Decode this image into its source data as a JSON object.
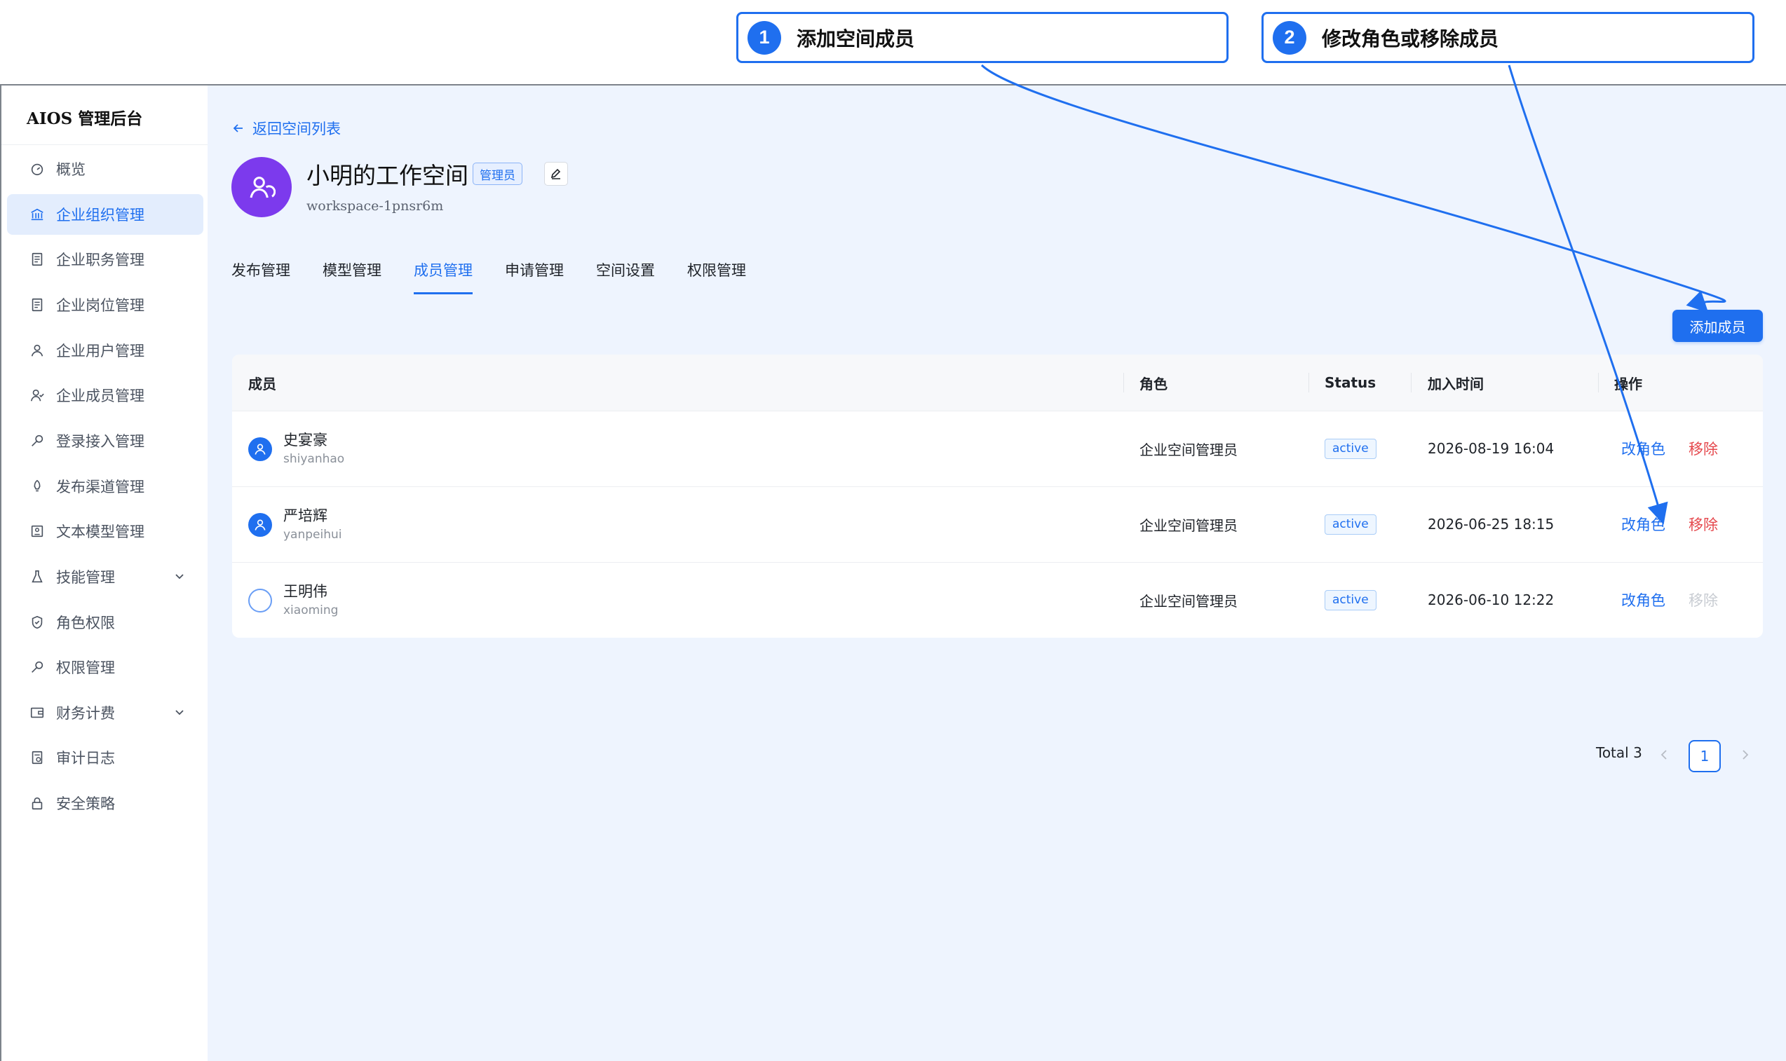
{
  "callouts": [
    {
      "number": "1",
      "text": "添加空间成员"
    },
    {
      "number": "2",
      "text": "修改角色或移除成员"
    }
  ],
  "brand": "AIOS 管理后台",
  "sidebar": {
    "items": [
      {
        "label": "概览",
        "icon": "dashboard-icon"
      },
      {
        "label": "企业组织管理",
        "icon": "bank-icon",
        "active": true
      },
      {
        "label": "企业职务管理",
        "icon": "document-icon"
      },
      {
        "label": "企业岗位管理",
        "icon": "document-icon"
      },
      {
        "label": "企业用户管理",
        "icon": "user-icon"
      },
      {
        "label": "企业成员管理",
        "icon": "users-icon"
      },
      {
        "label": "登录接入管理",
        "icon": "key-icon"
      },
      {
        "label": "发布渠道管理",
        "icon": "rocket-icon"
      },
      {
        "label": "文本模型管理",
        "icon": "model-icon"
      },
      {
        "label": "技能管理",
        "icon": "flask-icon",
        "expandable": true
      },
      {
        "label": "角色权限",
        "icon": "shield-icon"
      },
      {
        "label": "权限管理",
        "icon": "key-icon"
      },
      {
        "label": "财务计费",
        "icon": "wallet-icon",
        "expandable": true
      },
      {
        "label": "审计日志",
        "icon": "log-icon"
      },
      {
        "label": "安全策略",
        "icon": "lock-icon"
      }
    ]
  },
  "header": {
    "back_label": "返回空间列表",
    "workspace_name": "小明的工作空间",
    "role_badge": "管理员",
    "workspace_id": "workspace-1pnsr6m"
  },
  "tabs": [
    {
      "label": "发布管理"
    },
    {
      "label": "模型管理"
    },
    {
      "label": "成员管理",
      "active": true
    },
    {
      "label": "申请管理"
    },
    {
      "label": "空间设置"
    },
    {
      "label": "权限管理"
    }
  ],
  "add_member_label": "添加成员",
  "table": {
    "columns": [
      "成员",
      "角色",
      "Status",
      "加入时间",
      "操作"
    ],
    "rows": [
      {
        "name": "史宴豪",
        "login": "shiyanhao",
        "role": "企业空间管理员",
        "status": "active",
        "joined": "2026-08-19 16:04",
        "action_role": "改角色",
        "action_remove": "移除",
        "remove_disabled": false,
        "avatar": "filled"
      },
      {
        "name": "严培辉",
        "login": "yanpeihui",
        "role": "企业空间管理员",
        "status": "active",
        "joined": "2026-06-25 18:15",
        "action_role": "改角色",
        "action_remove": "移除",
        "remove_disabled": false,
        "avatar": "filled"
      },
      {
        "name": "王明伟",
        "login": "xiaoming",
        "role": "企业空间管理员",
        "status": "active",
        "joined": "2026-06-10 12:22",
        "action_role": "改角色",
        "action_remove": "移除",
        "remove_disabled": true,
        "avatar": "empty"
      }
    ]
  },
  "pagination": {
    "total_label": "Total 3",
    "current_page": "1"
  },
  "colors": {
    "accent": "#1f6fef",
    "danger": "#e5484d",
    "workspace_avatar": "#7c3aed",
    "content_bg": "#eef4fe"
  }
}
